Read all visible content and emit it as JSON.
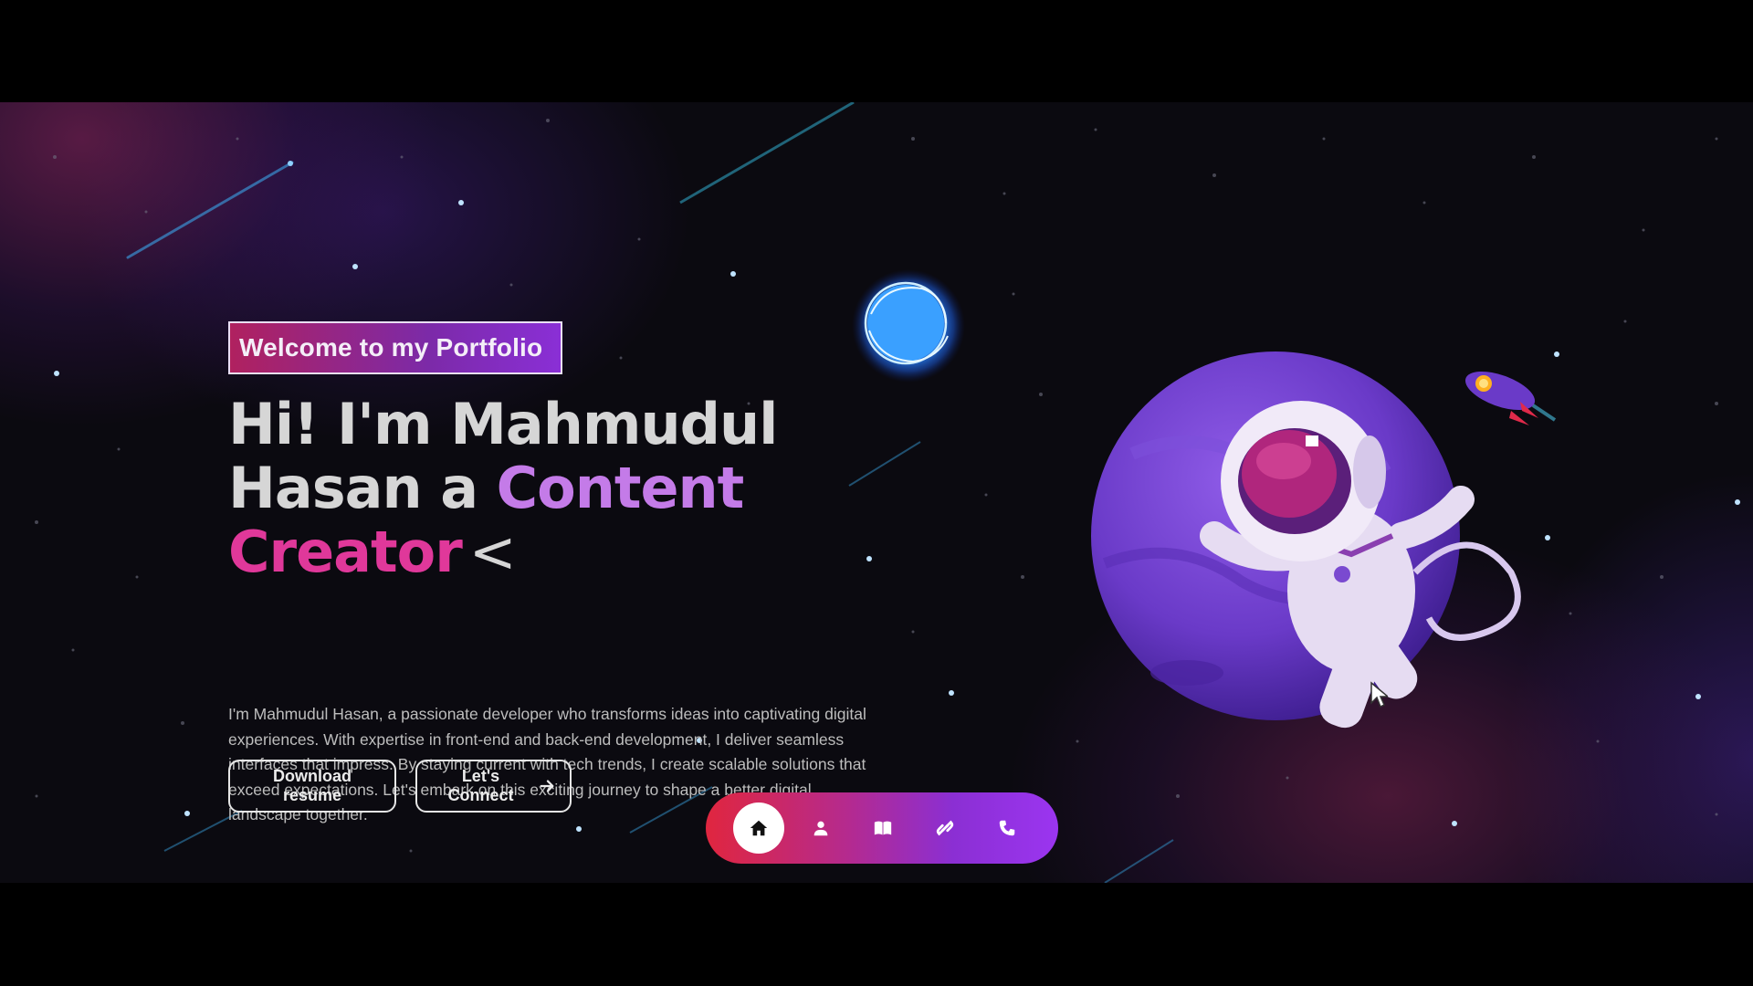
{
  "hero": {
    "welcome_badge": "Welcome to my Portfolio",
    "headline_prefix_1": "Hi! I'm Mahmudul",
    "headline_prefix_2": "Hasan a ",
    "headline_role_1": "Content",
    "headline_role_2": "Creator",
    "headline_cursor": "<",
    "intro": "I'm Mahmudul Hasan, a passionate developer who transforms ideas into captivating digital experiences. With expertise in front-end and back-end development, I deliver seamless interfaces that impress. By staying current with tech trends, I create scalable solutions that exceed expectations. Let's embark on this exciting journey to shape a better digital landscape together."
  },
  "buttons": {
    "download_resume": "Download resume",
    "lets_connect": "Let's Connect"
  },
  "bottom_nav": {
    "items": [
      {
        "icon": "home-icon",
        "active": true
      },
      {
        "icon": "user-icon",
        "active": false
      },
      {
        "icon": "book-icon",
        "active": false
      },
      {
        "icon": "link-icon",
        "active": false
      },
      {
        "icon": "phone-icon",
        "active": false
      }
    ]
  },
  "colors": {
    "accent_purple": "#c47be8",
    "accent_pink": "#e0389a",
    "nav_gradient_start": "#e0263f",
    "nav_gradient_end": "#9b35f0"
  }
}
